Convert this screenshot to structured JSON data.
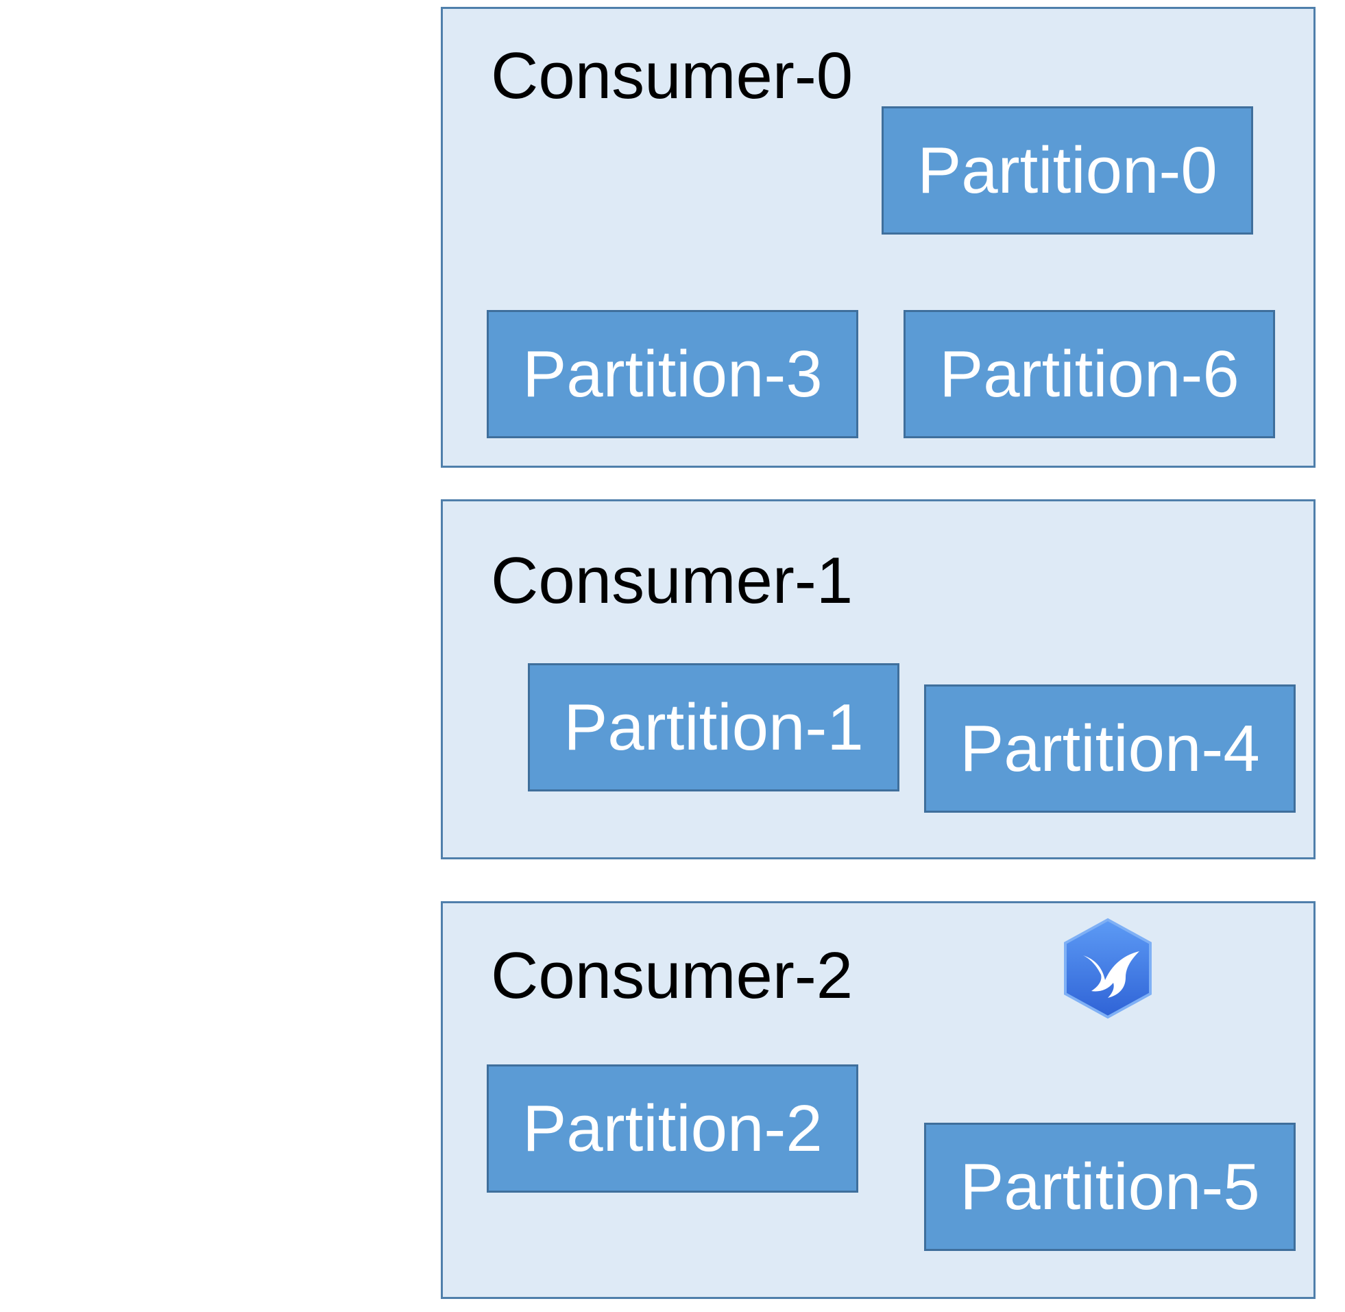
{
  "consumers": [
    {
      "label": "Consumer-0",
      "partitions": [
        "Partition-0",
        "Partition-3",
        "Partition-6"
      ]
    },
    {
      "label": "Consumer-1",
      "partitions": [
        "Partition-1",
        "Partition-4"
      ]
    },
    {
      "label": "Consumer-2",
      "partitions": [
        "Partition-2",
        "Partition-5"
      ]
    }
  ],
  "colors": {
    "consumer_fill": "#deeaf6",
    "consumer_border": "#4f7fab",
    "partition_fill": "#5b9bd5",
    "partition_border": "#3f6f9c",
    "partition_text": "#ffffff",
    "logo": "#3c7ae8"
  },
  "logo_icon": "bird-hexagon-icon"
}
